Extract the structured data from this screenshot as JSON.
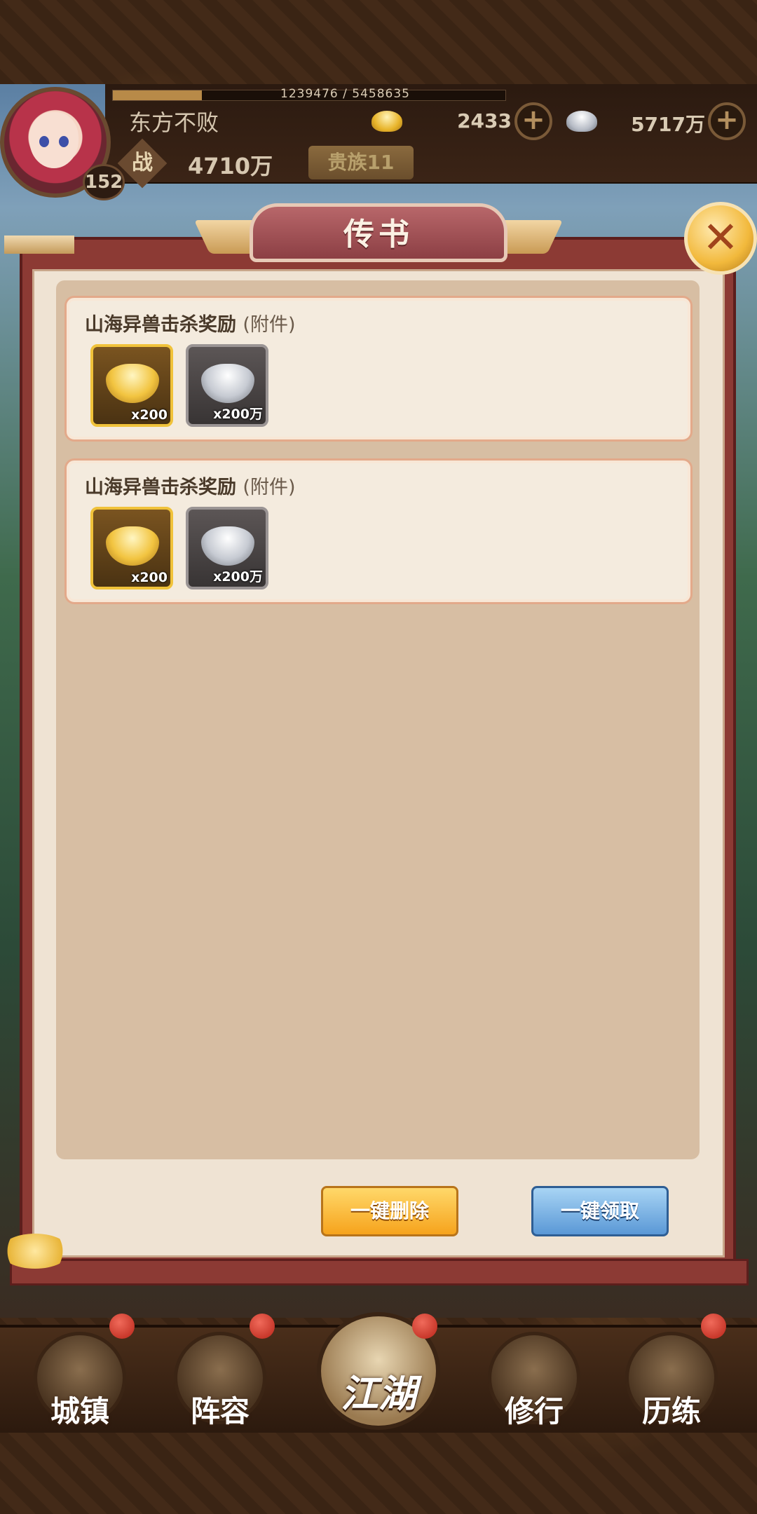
{
  "hud": {
    "exp_text": "1239476 / 5458635",
    "exp_progress": 0.227,
    "player_name": "东方不败",
    "level": "152",
    "gold_value": "2433",
    "silver_value": "5717万",
    "power_glyph": "战",
    "power_value": "4710万",
    "noble_badge": "贵族11",
    "plus": "+"
  },
  "dialog": {
    "title": "传书",
    "close_glyph": "✕"
  },
  "mails": [
    {
      "title": "山海异兽击杀奖励",
      "attach": "(附件)",
      "rewards": [
        {
          "icon": "gold-ingot-icon",
          "count": "x200"
        },
        {
          "icon": "silver-ingot-icon",
          "count": "x200万"
        }
      ]
    },
    {
      "title": "山海异兽击杀奖励",
      "attach": "(附件)",
      "rewards": [
        {
          "icon": "gold-ingot-icon",
          "count": "x200"
        },
        {
          "icon": "silver-ingot-icon",
          "count": "x200万"
        }
      ]
    }
  ],
  "buttons": {
    "delete_all": "一键删除",
    "claim_all": "一键领取"
  },
  "nav": {
    "items": [
      "城镇",
      "阵容",
      "江湖",
      "修行",
      "历练"
    ]
  },
  "colors": {
    "dialog_frame": "#8c3a34",
    "gold_button": "#f6a31c",
    "blue_button": "#5a98d6"
  }
}
